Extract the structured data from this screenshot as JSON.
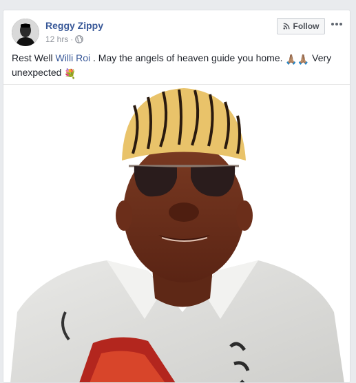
{
  "post": {
    "author": "Reggy Zippy",
    "timestamp": "12 hrs",
    "separator": "·",
    "privacy_icon": "globe-icon",
    "follow_label": "Follow",
    "follow_icon": "rss-icon",
    "more_icon": "more-dots-icon",
    "text_before": "Rest Well ",
    "mention": "Willi Roi",
    "text_after": " . May the angels of heaven guide you home. ",
    "emojis_praying": [
      "🙏🏽",
      "🙏🏽"
    ],
    "text_tail": " Very unexpected ",
    "emoji_bouquet": "💐"
  },
  "colors": {
    "link": "#385898",
    "meta": "#90949c",
    "text": "#1d2129"
  }
}
